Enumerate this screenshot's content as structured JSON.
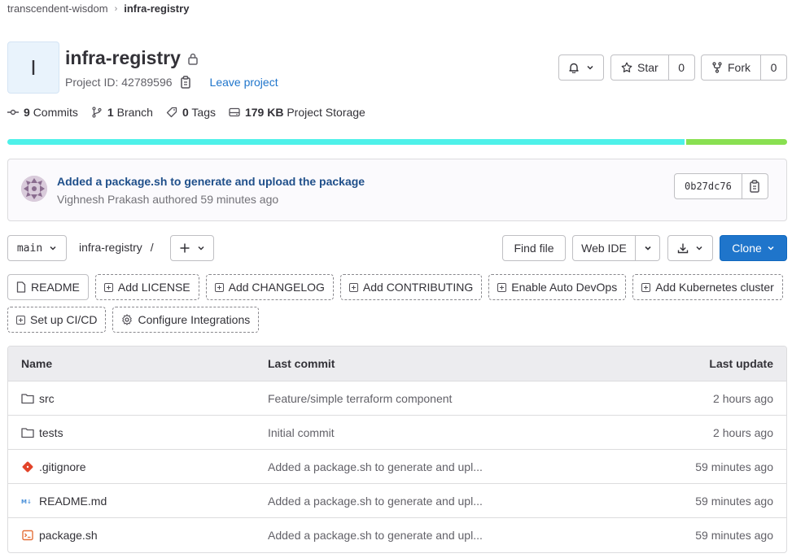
{
  "breadcrumb": {
    "group": "transcendent-wisdom",
    "project": "infra-registry"
  },
  "project": {
    "avatar_letter": "I",
    "name": "infra-registry",
    "id_label": "Project ID: 42789596",
    "leave_label": "Leave project"
  },
  "actions": {
    "star_label": "Star",
    "star_count": "0",
    "fork_label": "Fork",
    "fork_count": "0"
  },
  "stats": {
    "commits_count": "9",
    "commits_label": "Commits",
    "branches_count": "1",
    "branches_label": "Branch",
    "tags_count": "0",
    "tags_label": "Tags",
    "storage_size": "179 KB",
    "storage_label": "Project Storage"
  },
  "languages": {
    "colors": [
      "#4ef1e9",
      "#89e051"
    ],
    "shares": [
      0.87,
      0.13
    ]
  },
  "last_commit": {
    "title": "Added a package.sh to generate and upload the package",
    "author_line": "Vighnesh Prakash authored 59 minutes ago",
    "sha": "0b27dc76"
  },
  "toolbar": {
    "branch": "main",
    "path": "infra-registry",
    "path_sep": "/",
    "find_file": "Find file",
    "web_ide": "Web IDE",
    "clone": "Clone"
  },
  "chips": [
    {
      "label": "README",
      "icon": "file-icon",
      "style": "solid"
    },
    {
      "label": "Add LICENSE",
      "icon": "plus-square-icon",
      "style": "dashed"
    },
    {
      "label": "Add CHANGELOG",
      "icon": "plus-square-icon",
      "style": "dashed"
    },
    {
      "label": "Add CONTRIBUTING",
      "icon": "plus-square-icon",
      "style": "dashed"
    },
    {
      "label": "Enable Auto DevOps",
      "icon": "plus-square-icon",
      "style": "dashed"
    },
    {
      "label": "Add Kubernetes cluster",
      "icon": "plus-square-icon",
      "style": "dashed"
    },
    {
      "label": "Set up CI/CD",
      "icon": "plus-square-icon",
      "style": "dashed"
    },
    {
      "label": "Configure Integrations",
      "icon": "settings-icon",
      "style": "dashed"
    }
  ],
  "table": {
    "headers": {
      "name": "Name",
      "commit": "Last commit",
      "update": "Last update"
    },
    "rows": [
      {
        "name": "src",
        "icon": "folder-icon",
        "commit": "Feature/simple terraform component",
        "update": "2 hours ago"
      },
      {
        "name": "tests",
        "icon": "folder-icon",
        "commit": "Initial commit",
        "update": "2 hours ago"
      },
      {
        "name": ".gitignore",
        "icon": "git-icon",
        "commit": "Added a package.sh to generate and upl...",
        "update": "59 minutes ago"
      },
      {
        "name": "README.md",
        "icon": "markdown-icon",
        "commit": "Added a package.sh to generate and upl...",
        "update": "59 minutes ago"
      },
      {
        "name": "package.sh",
        "icon": "terminal-icon",
        "commit": "Added a package.sh to generate and upl...",
        "update": "59 minutes ago"
      }
    ]
  }
}
